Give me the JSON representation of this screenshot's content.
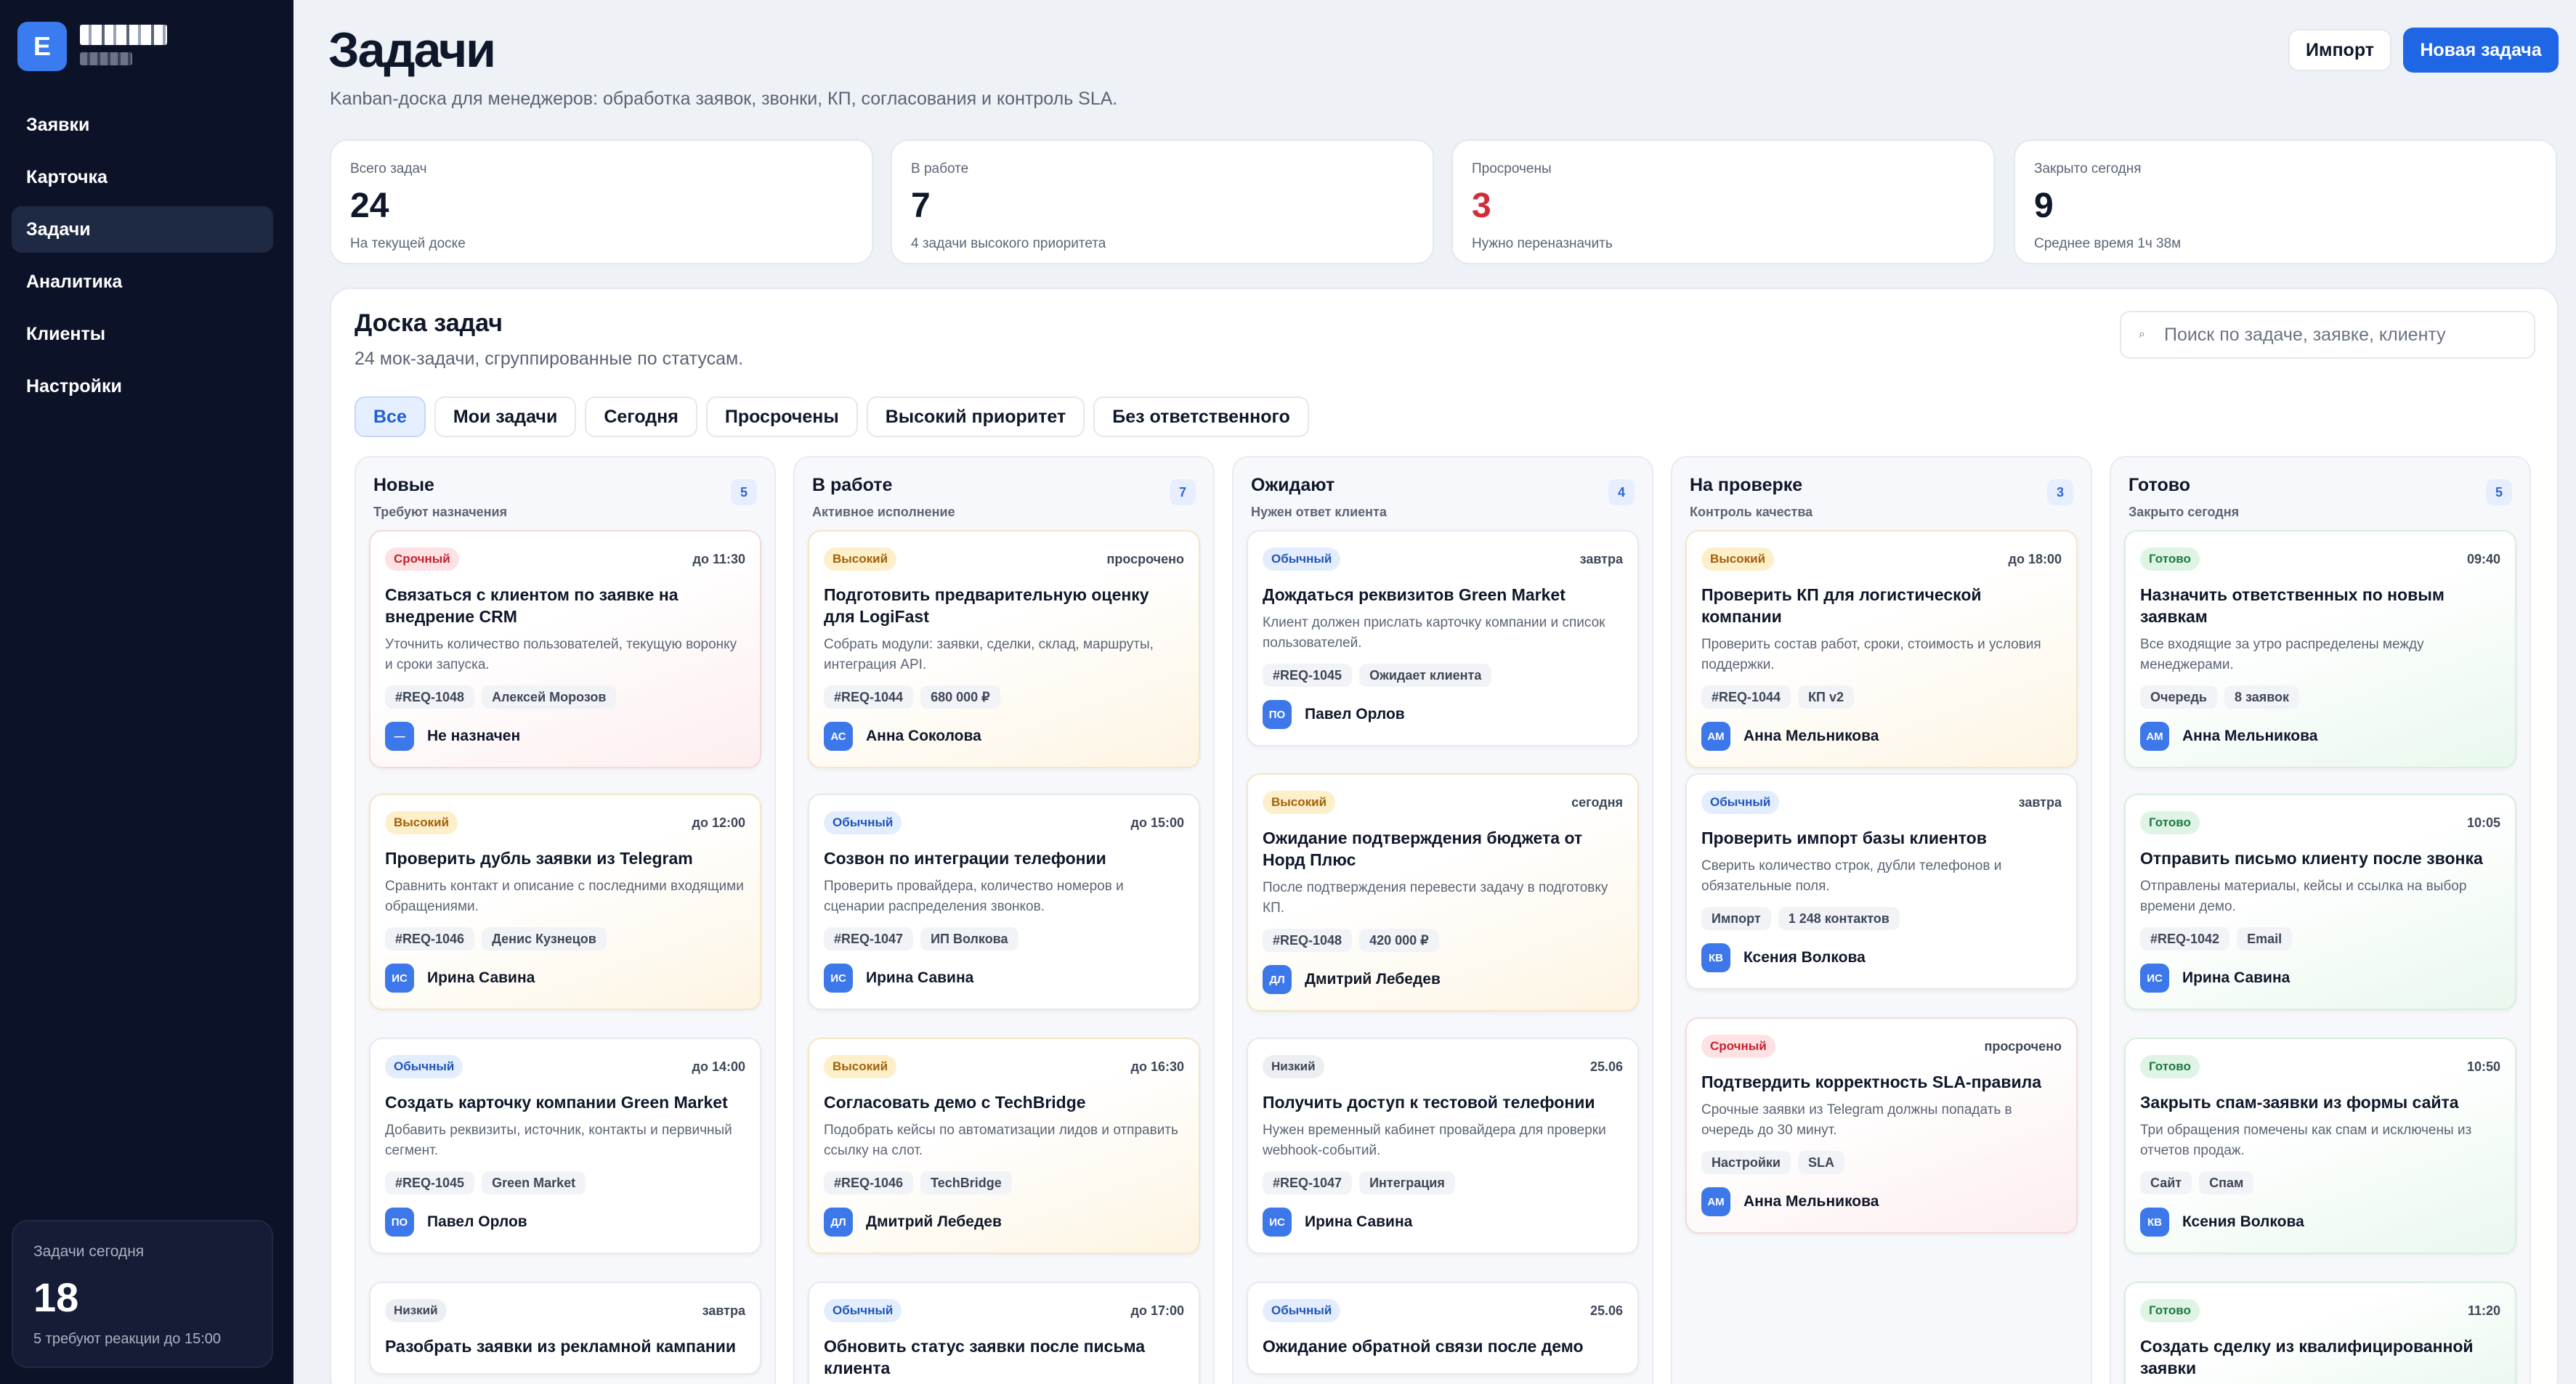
{
  "brand": {
    "logo_letter": "E"
  },
  "sidebar": {
    "items": [
      {
        "label": "Заявки"
      },
      {
        "label": "Карточка"
      },
      {
        "label": "Задачи"
      },
      {
        "label": "Аналитика"
      },
      {
        "label": "Клиенты"
      },
      {
        "label": "Настройки"
      }
    ],
    "active_index": 2,
    "today": {
      "label": "Задачи сегодня",
      "value": "18",
      "hint": "5 требуют реакции до 15:00"
    }
  },
  "header": {
    "title": "Задачи",
    "subtitle": "Kanban-доска для менеджеров: обработка заявок, звонки, КП, согласования и контроль SLA.",
    "import_label": "Импорт",
    "new_task_label": "Новая задача"
  },
  "stats": [
    {
      "label": "Всего задач",
      "value": "24",
      "hint": "На текущей доске"
    },
    {
      "label": "В работе",
      "value": "7",
      "hint": "4 задачи высокого приоритета"
    },
    {
      "label": "Просрочены",
      "value": "3",
      "hint": "Нужно переназначить"
    },
    {
      "label": "Закрыто сегодня",
      "value": "9",
      "hint": "Среднее время 1ч 38м"
    }
  ],
  "board": {
    "title": "Доска задач",
    "subtitle": "24 мок-задачи, сгруппированные по статусам.",
    "search_placeholder": "Поиск по задаче, заявке, клиенту",
    "filters": [
      "Все",
      "Мои задачи",
      "Сегодня",
      "Просрочены",
      "Высокий приоритет",
      "Без ответственного"
    ],
    "columns": [
      {
        "title": "Новые",
        "subtitle": "Требуют назначения",
        "count": "5"
      },
      {
        "title": "В работе",
        "subtitle": "Активное исполнение",
        "count": "7"
      },
      {
        "title": "Ожидают",
        "subtitle": "Нужен ответ клиента",
        "count": "4"
      },
      {
        "title": "На проверке",
        "subtitle": "Контроль качества",
        "count": "3"
      },
      {
        "title": "Готово",
        "subtitle": "Закрыто сегодня",
        "count": "5"
      }
    ],
    "cards": {
      "c0": [
        {
          "priority": "Срочный",
          "due": "до 11:30",
          "title": "Связаться с клиентом по заявке на внедрение CRM",
          "desc": "Уточнить количество пользователей, текущую воронку и сроки запуска.",
          "tags": [
            "#REQ-1048",
            "Алексей Морозов"
          ],
          "avatar": "—",
          "owner": "Не назначен"
        },
        {
          "priority": "Высокий",
          "due": "до 12:00",
          "title": "Проверить дубль заявки из Telegram",
          "desc": "Сравнить контакт и описание с последними входящими обращениями.",
          "tags": [
            "#REQ-1046",
            "Денис Кузнецов"
          ],
          "avatar": "ИС",
          "owner": "Ирина Савина"
        },
        {
          "priority": "Обычный",
          "due": "до 14:00",
          "title": "Создать карточку компании Green Market",
          "desc": "Добавить реквизиты, источник, контакты и первичный сегмент.",
          "tags": [
            "#REQ-1045",
            "Green Market"
          ],
          "avatar": "ПО",
          "owner": "Павел Орлов"
        },
        {
          "priority": "Низкий",
          "due": "завтра",
          "title": "Разобрать заявки из рекламной кампании"
        }
      ],
      "c1": [
        {
          "priority": "Высокий",
          "due": "просрочено",
          "title": "Подготовить предварительную оценку для LogiFast",
          "desc": "Собрать модули: заявки, сделки, склад, маршруты, интеграция API.",
          "tags": [
            "#REQ-1044",
            "680 000 ₽"
          ],
          "avatar": "АС",
          "owner": "Анна Соколова"
        },
        {
          "priority": "Обычный",
          "due": "до 15:00",
          "title": "Созвон по интеграции телефонии",
          "desc": "Проверить провайдера, количество номеров и сценарии распределения звонков.",
          "tags": [
            "#REQ-1047",
            "ИП Волкова"
          ],
          "avatar": "ИС",
          "owner": "Ирина Савина"
        },
        {
          "priority": "Высокий",
          "due": "до 16:30",
          "title": "Согласовать демо с TechBridge",
          "desc": "Подобрать кейсы по автоматизации лидов и отправить ссылку на слот.",
          "tags": [
            "#REQ-1046",
            "TechBridge"
          ],
          "avatar": "ДЛ",
          "owner": "Дмитрий Лебедев"
        },
        {
          "priority": "Обычный",
          "due": "до 17:00",
          "title": "Обновить статус заявки после письма клиента"
        }
      ],
      "c2": [
        {
          "priority": "Обычный",
          "due": "завтра",
          "title": "Дождаться реквизитов Green Market",
          "desc": "Клиент должен прислать карточку компании и список пользователей.",
          "tags": [
            "#REQ-1045",
            "Ожидает клиента"
          ],
          "avatar": "ПО",
          "owner": "Павел Орлов"
        },
        {
          "priority": "Высокий",
          "due": "сегодня",
          "title": "Ожидание подтверждения бюджета от Норд Плюс",
          "desc": "После подтверждения перевести задачу в подготовку КП.",
          "tags": [
            "#REQ-1048",
            "420 000 ₽"
          ],
          "avatar": "ДЛ",
          "owner": "Дмитрий Лебедев"
        },
        {
          "priority": "Низкий",
          "due": "25.06",
          "title": "Получить доступ к тестовой телефонии",
          "desc": "Нужен временный кабинет провайдера для проверки webhook-событий.",
          "tags": [
            "#REQ-1047",
            "Интеграция"
          ],
          "avatar": "ИС",
          "owner": "Ирина Савина"
        },
        {
          "priority": "Обычный",
          "due": "25.06",
          "title": "Ожидание обратной связи после демо"
        }
      ],
      "c3": [
        {
          "priority": "Высокий",
          "due": "до 18:00",
          "title": "Проверить КП для логистической компании",
          "desc": "Проверить состав работ, сроки, стоимость и условия поддержки.",
          "tags": [
            "#REQ-1044",
            "КП v2"
          ],
          "avatar": "АМ",
          "owner": "Анна Мельникова"
        },
        {
          "priority": "Обычный",
          "due": "завтра",
          "title": "Проверить импорт базы клиентов",
          "desc": "Сверить количество строк, дубли телефонов и обязательные поля.",
          "tags": [
            "Импорт",
            "1 248 контактов"
          ],
          "avatar": "КВ",
          "owner": "Ксения Волкова"
        },
        {
          "priority": "Срочный",
          "due": "просрочено",
          "title": "Подтвердить корректность SLA-правила",
          "desc": "Срочные заявки из Telegram должны попадать в очередь до 30 минут.",
          "tags": [
            "Настройки",
            "SLA"
          ],
          "avatar": "АМ",
          "owner": "Анна Мельникова"
        }
      ],
      "c4": [
        {
          "priority": "Готово",
          "due": "09:40",
          "title": "Назначить ответственных по новым заявкам",
          "desc": "Все входящие за утро распределены между менеджерами.",
          "tags": [
            "Очередь",
            "8 заявок"
          ],
          "avatar": "АМ",
          "owner": "Анна Мельникова"
        },
        {
          "priority": "Готово",
          "due": "10:05",
          "title": "Отправить письмо клиенту после звонка",
          "desc": "Отправлены материалы, кейсы и ссылка на выбор времени демо.",
          "tags": [
            "#REQ-1042",
            "Email"
          ],
          "avatar": "ИС",
          "owner": "Ирина Савина"
        },
        {
          "priority": "Готово",
          "due": "10:50",
          "title": "Закрыть спам-заявки из формы сайта",
          "desc": "Три обращения помечены как спам и исключены из отчетов продаж.",
          "tags": [
            "Сайт",
            "Спам"
          ],
          "avatar": "КВ",
          "owner": "Ксения Волкова"
        },
        {
          "priority": "Готово",
          "due": "11:20",
          "title": "Создать сделку из квалифицированной заявки"
        }
      ]
    }
  },
  "colors": {
    "accent": "#1f66e5",
    "sidebar": "#0c1329",
    "danger": "#d52b36",
    "urgent": "#c4222e",
    "high": "#a3610b",
    "normal": "#2156b8",
    "done": "#1c7a3e"
  }
}
